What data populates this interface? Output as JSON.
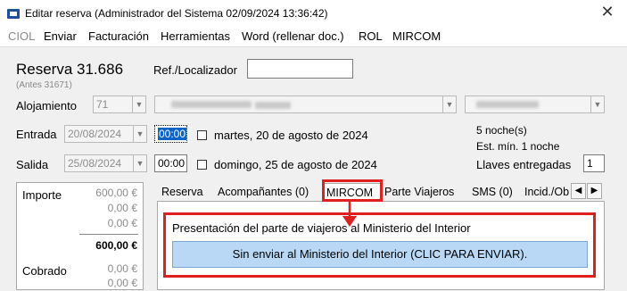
{
  "window": {
    "title": "Editar reserva  (Administrador del Sistema 02/09/2024 13:36:42)",
    "close_glyph": "✕"
  },
  "menu": {
    "items": [
      "CIOL",
      "Enviar",
      "Facturación",
      "Herramientas",
      "Word (rellenar doc.)",
      "ROL",
      "MIRCOM"
    ]
  },
  "reserva": {
    "title": "Reserva 31.686",
    "previous": "(Antes 31671)",
    "ref_label": "Ref./Localizador",
    "ref_value": ""
  },
  "alojamiento": {
    "label": "Alojamiento",
    "number": "71"
  },
  "entrada": {
    "label": "Entrada",
    "date": "20/08/2024",
    "time": "00:00",
    "text": "martes, 20 de agosto de 2024"
  },
  "salida": {
    "label": "Salida",
    "date": "25/08/2024",
    "time": "00:00",
    "text": "domingo, 25 de agosto de 2024"
  },
  "stay": {
    "nights": "5 noche(s)",
    "minimum": "Est. mín. 1 noche",
    "keys_label": "Llaves entregadas",
    "keys_value": "1"
  },
  "amounts": {
    "importe_label": "Importe",
    "importe_values": [
      "600,00 €",
      "0,00 €",
      "0,00 €"
    ],
    "importe_total": "600,00 €",
    "cobrado_label": "Cobrado",
    "cobrado_values": [
      "0,00 €",
      "0,00 €"
    ]
  },
  "tabs": [
    {
      "label": "Reserva"
    },
    {
      "label": "Acompañantes (0)"
    },
    {
      "label": "MIRCOM"
    },
    {
      "label": "Parte Viajeros"
    },
    {
      "label": "SMS (0)"
    },
    {
      "label": "Incid./Ob"
    }
  ],
  "mircom": {
    "heading": "Presentación del parte de viajeros al Ministerio del Interior",
    "button": "Sin enviar al Ministerio del Interior (CLIC PARA ENVIAR)."
  },
  "colors": {
    "highlight": "#e0201e",
    "button_bg": "#b8d8f5",
    "selection": "#0a63c9"
  },
  "icons": {
    "dropdown": "▼",
    "tab_prev": "◀",
    "tab_next": "▶"
  }
}
